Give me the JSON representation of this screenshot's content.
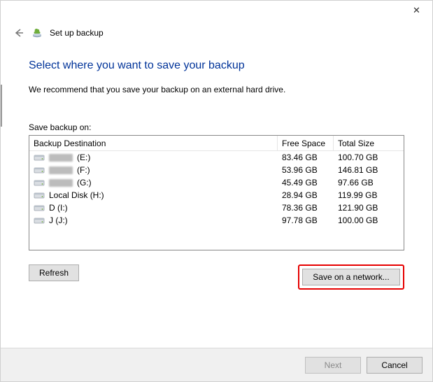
{
  "window": {
    "title": "Set up backup"
  },
  "content": {
    "heading": "Select where you want to save your backup",
    "subtext": "We recommend that you save your backup on an external hard drive.",
    "list_label": "Save backup on:"
  },
  "columns": {
    "destination": "Backup Destination",
    "free": "Free Space",
    "total": "Total Size"
  },
  "drives": [
    {
      "label_prefix_blurred": true,
      "label": "(E:)",
      "free": "83.46 GB",
      "total": "100.70 GB"
    },
    {
      "label_prefix_blurred": true,
      "label": "(F:)",
      "free": "53.96 GB",
      "total": "146.81 GB"
    },
    {
      "label_prefix_blurred": true,
      "label": "(G:)",
      "free": "45.49 GB",
      "total": "97.66 GB"
    },
    {
      "label_prefix_blurred": false,
      "label": "Local Disk (H:)",
      "free": "28.94 GB",
      "total": "119.99 GB"
    },
    {
      "label_prefix_blurred": false,
      "label": "D (I:)",
      "free": "78.36 GB",
      "total": "121.90 GB"
    },
    {
      "label_prefix_blurred": false,
      "label": "J (J:)",
      "free": "97.78 GB",
      "total": "100.00 GB"
    }
  ],
  "buttons": {
    "refresh": "Refresh",
    "save_network": "Save on a network...",
    "next": "Next",
    "cancel": "Cancel"
  }
}
